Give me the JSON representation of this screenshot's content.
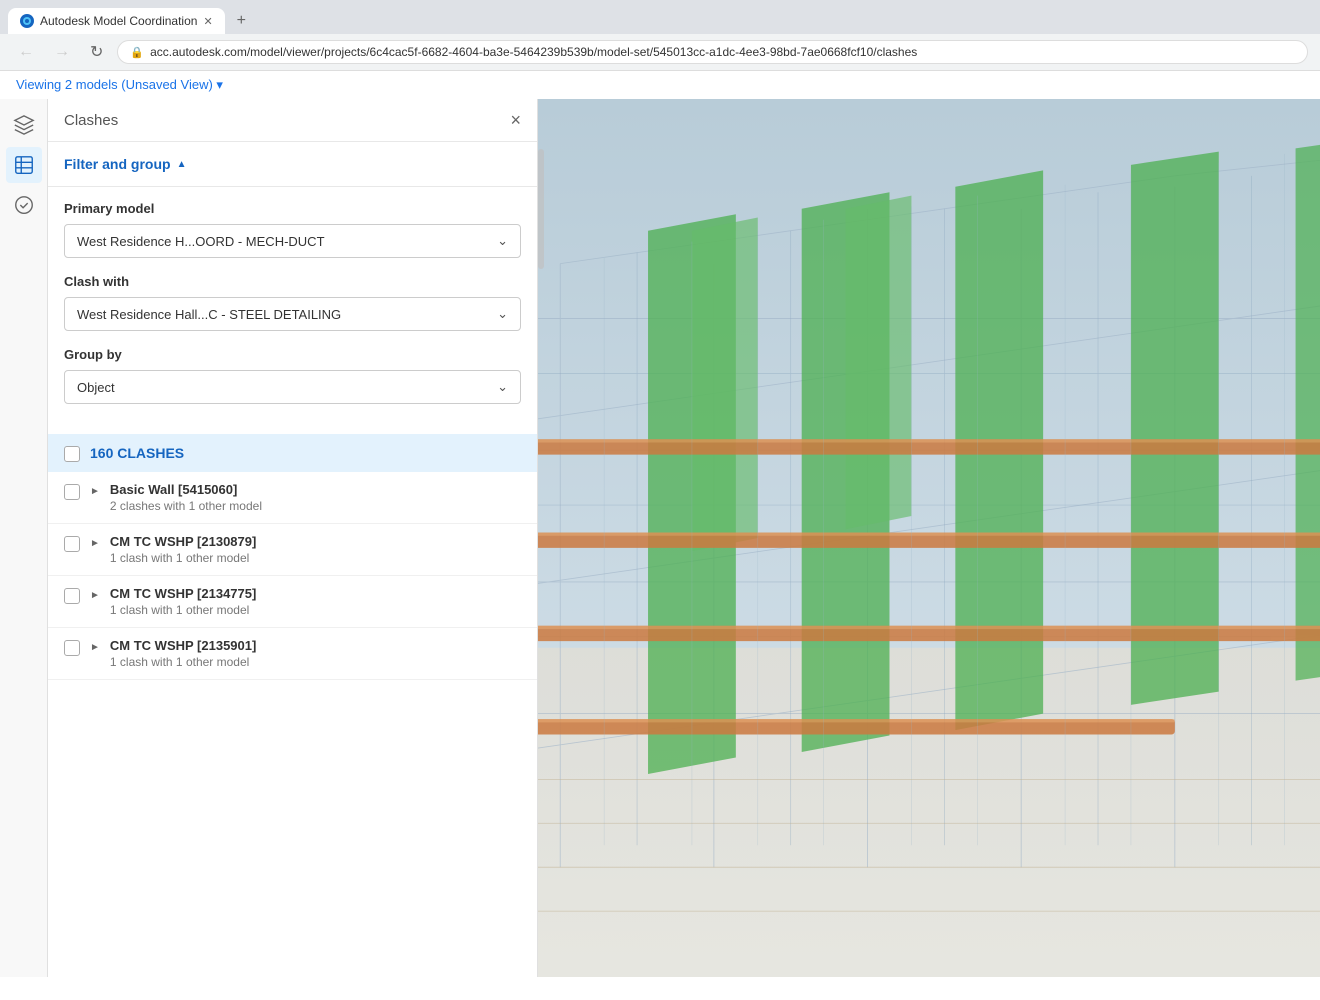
{
  "browser": {
    "tab_title": "Autodesk Model Coordination",
    "tab_favicon": "🌐",
    "url": "acc.autodesk.com/model/viewer/projects/6c4cac5f-6682-4604-ba3e-5464239b539b/model-set/545013cc-a1dc-4ee3-98bd-7ae0668fcf10/clashes",
    "new_tab_label": "+"
  },
  "app_header": {
    "viewing_text": "Viewing 2 models (Unsaved View)",
    "dropdown_arrow": "▾"
  },
  "panel": {
    "title": "Clashes",
    "close_label": "×",
    "filter_group_label": "Filter and group",
    "filter_group_arrow": "▲",
    "primary_model_label": "Primary model",
    "primary_model_value": "West Residence H...OORD - MECH-DUCT",
    "clash_with_label": "Clash with",
    "clash_with_value": "West Residence Hall...C - STEEL DETAILING",
    "group_by_label": "Group by",
    "group_by_value": "Object",
    "clashes_count_label": "160 CLASHES",
    "clash_items": [
      {
        "name": "Basic Wall [5415060]",
        "detail": "2 clashes with 1 other model"
      },
      {
        "name": "CM TC WSHP [2130879]",
        "detail": "1 clash with 1 other model"
      },
      {
        "name": "CM TC WSHP [2134775]",
        "detail": "1 clash with 1 other model"
      },
      {
        "name": "CM TC WSHP [2135901]",
        "detail": "1 clash with 1 other model"
      }
    ]
  },
  "toolbar": {
    "icons": [
      {
        "name": "cube-icon",
        "symbol": "⬡",
        "active": false
      },
      {
        "name": "layers-icon",
        "symbol": "⬜",
        "active": true
      },
      {
        "name": "checkmark-icon",
        "symbol": "✓",
        "active": false
      }
    ]
  },
  "viewer": {
    "background_color": "#c8d4de"
  }
}
